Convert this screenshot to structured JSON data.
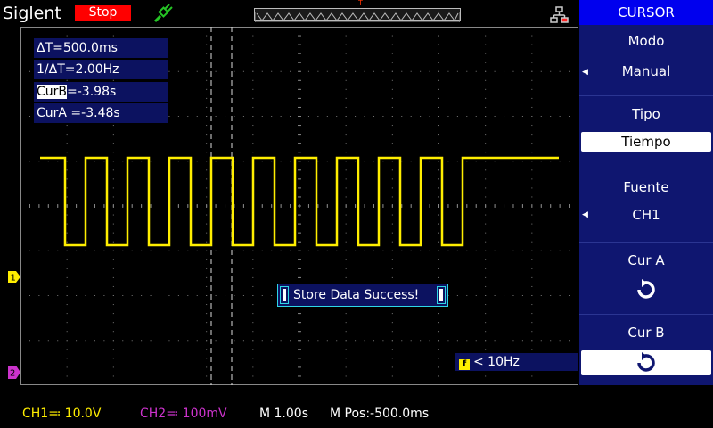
{
  "topbar": {
    "brand": "Siglent",
    "run_state": "Stop",
    "trigger_marker": "T",
    "icons": [
      "usb-icon",
      "network-icon"
    ]
  },
  "menu": {
    "title": "CURSOR",
    "items": [
      {
        "label": "Modo",
        "value": "Manual",
        "selected": false,
        "has_arrow": true
      },
      {
        "label": "Tipo",
        "value": "Tiempo",
        "selected": true,
        "has_arrow": false
      },
      {
        "label": "Fuente",
        "value": "CH1",
        "selected": false,
        "has_arrow": true
      },
      {
        "label": "Cur A",
        "icon": "rotate-knob-icon",
        "selected": false
      },
      {
        "label": "Cur B",
        "icon": "rotate-knob-icon",
        "selected": true
      }
    ]
  },
  "readout": {
    "delta_t": "ΔT=500.0ms",
    "inv_delta_t": "1/ΔT=2.00Hz",
    "curb_label": "CurB",
    "curb_value": "=-3.98s",
    "cura": "CurA =-3.48s"
  },
  "message": "Store Data Success!",
  "freq_counter": {
    "icon": "f",
    "text": "< 10Hz"
  },
  "channel_markers": {
    "ch1": "1",
    "ch2": "2"
  },
  "status": {
    "ch1": "CH1≕ 10.0V",
    "ch2": "CH2≕ 100mV",
    "timebase": "M 1.00s",
    "mpos": "M Pos:-500.0ms"
  },
  "colors": {
    "ch1": "#ffee00",
    "ch2": "#cc33cc",
    "menu_bg": "#0f1670",
    "menu_header": "#0000ee",
    "stop": "#ff0000",
    "grid": "#777777"
  },
  "waveform": {
    "type": "square",
    "channel": "CH1",
    "pulses": 10
  }
}
